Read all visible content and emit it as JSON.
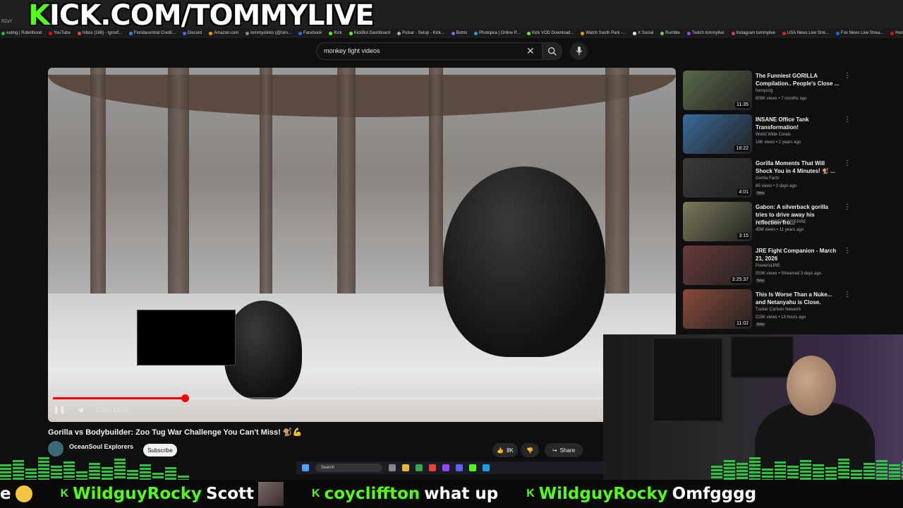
{
  "banner": {
    "k_letter": "K",
    "text": "ICK.COM/TOMMYLIVE",
    "tiny_left": "RZaY"
  },
  "bookmarks": [
    {
      "label": "eating | Robinhood",
      "color": "#1db954"
    },
    {
      "label": "YouTube",
      "color": "#ff0000"
    },
    {
      "label": "Inbox (168) - tgroof...",
      "color": "#ea4335"
    },
    {
      "label": "Floridacentral Credit...",
      "color": "#3b82f6"
    },
    {
      "label": "Discord",
      "color": "#5865f2"
    },
    {
      "label": "Amazon.com",
      "color": "#ff9900"
    },
    {
      "label": "tommyslinks (@tom...",
      "color": "#888888"
    },
    {
      "label": "Facebook",
      "color": "#1877f2"
    },
    {
      "label": "Kick",
      "color": "#53fc18"
    },
    {
      "label": "KickBot Dashboard",
      "color": "#53fc18"
    },
    {
      "label": "Pulsar - Setup - Kick...",
      "color": "#aaaaaa"
    },
    {
      "label": "Botrix",
      "color": "#8b5cf6"
    },
    {
      "label": "Photopea | Online P...",
      "color": "#1ba1e2"
    },
    {
      "label": "Kick VOD Download...",
      "color": "#53fc18"
    },
    {
      "label": "Watch South Park -...",
      "color": "#f59e0b"
    },
    {
      "label": "X Social",
      "color": "#ffffff"
    },
    {
      "label": "Rumble",
      "color": "#85c742"
    },
    {
      "label": "Twitch tommylive",
      "color": "#9146ff"
    },
    {
      "label": "Instagram tommylive",
      "color": "#e1306c"
    },
    {
      "label": "USA News Live Stre...",
      "color": "#dc2626"
    },
    {
      "label": "Fox News Live Strea...",
      "color": "#2563eb"
    },
    {
      "label": "Home - Netflix",
      "color": "#e50914"
    }
  ],
  "search": {
    "query": "monkey fight videos"
  },
  "video": {
    "progress": 0.24,
    "time": "2:14 / 10:45",
    "preview_time": "2:18"
  },
  "below": {
    "title": "Gorilla vs Bodybuilder: Zoo Tug War Challenge You Can't Miss! 🐒💪",
    "channel": "OceanSoul Explorers",
    "subscribe": "Subscribe",
    "likes": "8K",
    "share": "Share"
  },
  "recommendations": [
    {
      "title": "The Funniest GORILLA Compilation.. People's Close ...",
      "channel": "funnyozg",
      "meta": "808K views • 7 months ago",
      "duration": "11:35",
      "new": "",
      "thumb": "#5a6a4a"
    },
    {
      "title": "INSANE Office Tank Transformation!",
      "channel": "World Wide Corals",
      "meta": "18K views • 2 years ago",
      "duration": "18:22",
      "new": "",
      "thumb": "#3a6a9a"
    },
    {
      "title": "Gorilla Moments That Will Shock You in 4 Minutes! 🐒 ...",
      "channel": "Gorilla Facts",
      "meta": "85 views • 3 days ago",
      "duration": "4:01",
      "new": "New",
      "thumb": "#3a3a3a"
    },
    {
      "title": "Gabon: A silverback gorilla tries to drive away his reflection fro...",
      "channel": "Xavier HUBERT-BRIERRE",
      "meta": "45M views • 11 years ago",
      "duration": "3:15",
      "new": "",
      "thumb": "#7a7a5a"
    },
    {
      "title": "JRE Fight Companion - March 21, 2026",
      "channel": "PowerfulJRE",
      "meta": "553K views • Streamed 3 days ago",
      "duration": "3:25:37",
      "new": "New",
      "thumb": "#6a3a3a"
    },
    {
      "title": "This Is Worse Than a Nuke... and Netanyahu is Close.",
      "channel": "Tucker Carlson Network",
      "meta": "215K views • 13 hours ago",
      "duration": "11:02",
      "new": "New",
      "thumb": "#8a4a3a"
    }
  ],
  "taskbar": {
    "search": "Search"
  },
  "ticker": [
    {
      "user": "",
      "msg": "e",
      "lead_emoji": true
    },
    {
      "user": "WildguyRocky",
      "msg": "Scott",
      "emote": true
    },
    {
      "user": "coycliffton",
      "msg": "what up"
    },
    {
      "user": "WildguyRocky",
      "msg": "Omfgggg"
    }
  ],
  "colors": {
    "kick_green": "#53fc18",
    "progress_red": "#ff0000",
    "eq_green": "#2ecc40"
  }
}
